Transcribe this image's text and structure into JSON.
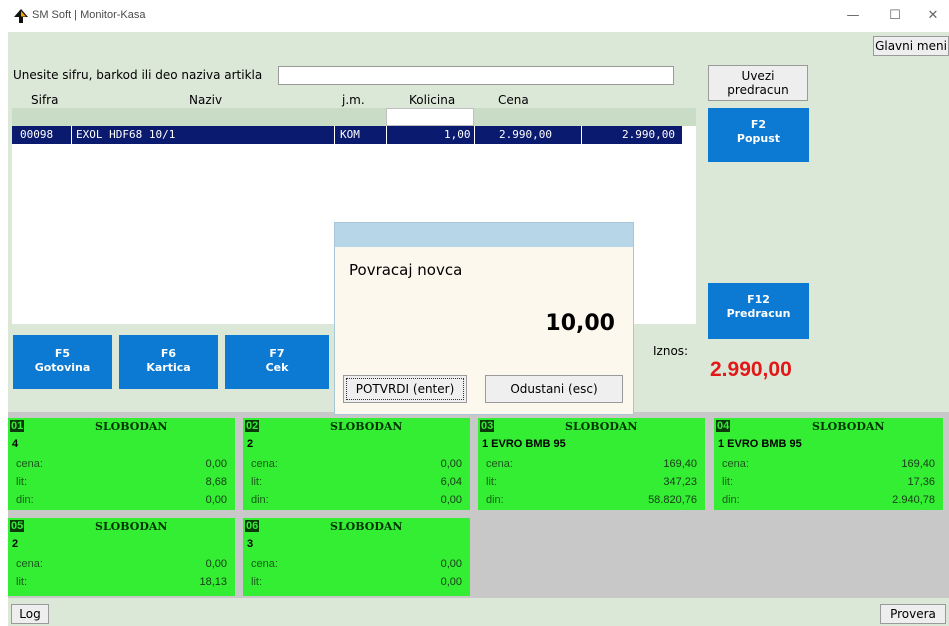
{
  "window": {
    "title": "SM Soft | Monitor-Kasa",
    "controls": [
      "—",
      "☐",
      "✕"
    ]
  },
  "toolbar": {
    "main_menu": "Glavni meni"
  },
  "search": {
    "label": "Unesite sifru, barkod ili deo naziva artikla",
    "value": ""
  },
  "import_button": "Uvezi predracun",
  "table": {
    "headers": [
      "Sifra",
      "Naziv",
      "j.m.",
      "Kolicina",
      "Cena"
    ],
    "rows": [
      {
        "sifra": "00098",
        "naziv": "EXOL HDF68 10/1",
        "jm": "KOM",
        "kolicina": "1,00",
        "cena": "2.990,00",
        "iznos": "2.990,00"
      }
    ]
  },
  "fkeys": {
    "f2": {
      "key": "F2",
      "label": "Popust"
    },
    "f12": {
      "key": "F12",
      "label": "Predracun"
    },
    "f5": {
      "key": "F5",
      "label": "Gotovina"
    },
    "f6": {
      "key": "F6",
      "label": "Kartica"
    },
    "f7": {
      "key": "F7",
      "label": "Cek"
    }
  },
  "total": {
    "label": "Iznos:",
    "value": "2.990,00",
    "color": "#e21818"
  },
  "dialog": {
    "label": "Povracaj novca",
    "value": "10,00",
    "confirm": "POTVRDI (enter)",
    "cancel": "Odustani (esc)"
  },
  "pumps": [
    {
      "num": "01",
      "status": "SLOBODAN",
      "line": "4",
      "cena": "0,00",
      "lit": "8,68",
      "din": "0,00"
    },
    {
      "num": "02",
      "status": "SLOBODAN",
      "line": "2",
      "cena": "0,00",
      "lit": "6,04",
      "din": "0,00"
    },
    {
      "num": "03",
      "status": "SLOBODAN",
      "line": "1 EVRO BMB 95",
      "cena": "169,40",
      "lit": "347,23",
      "din": "58.820,76"
    },
    {
      "num": "04",
      "status": "SLOBODAN",
      "line": "1 EVRO BMB 95",
      "cena": "169,40",
      "lit": "17,36",
      "din": "2.940,78"
    },
    {
      "num": "05",
      "status": "SLOBODAN",
      "line": "2",
      "cena": "0,00",
      "lit": "18,13"
    },
    {
      "num": "06",
      "status": "SLOBODAN",
      "line": "3",
      "cena": "0,00",
      "lit": "0,00"
    }
  ],
  "pump_labels": {
    "cena": "cena:",
    "lit": "lit:",
    "din": "din:"
  },
  "status": {
    "log": "Log",
    "check": "Provera"
  },
  "colors": {
    "background": "#dbe8d8",
    "fkey_blue": "#0c79d2",
    "pump_green": "#33ee33",
    "selected_row": "#0a1a6e",
    "dialog_title": "#b7d6e8"
  }
}
